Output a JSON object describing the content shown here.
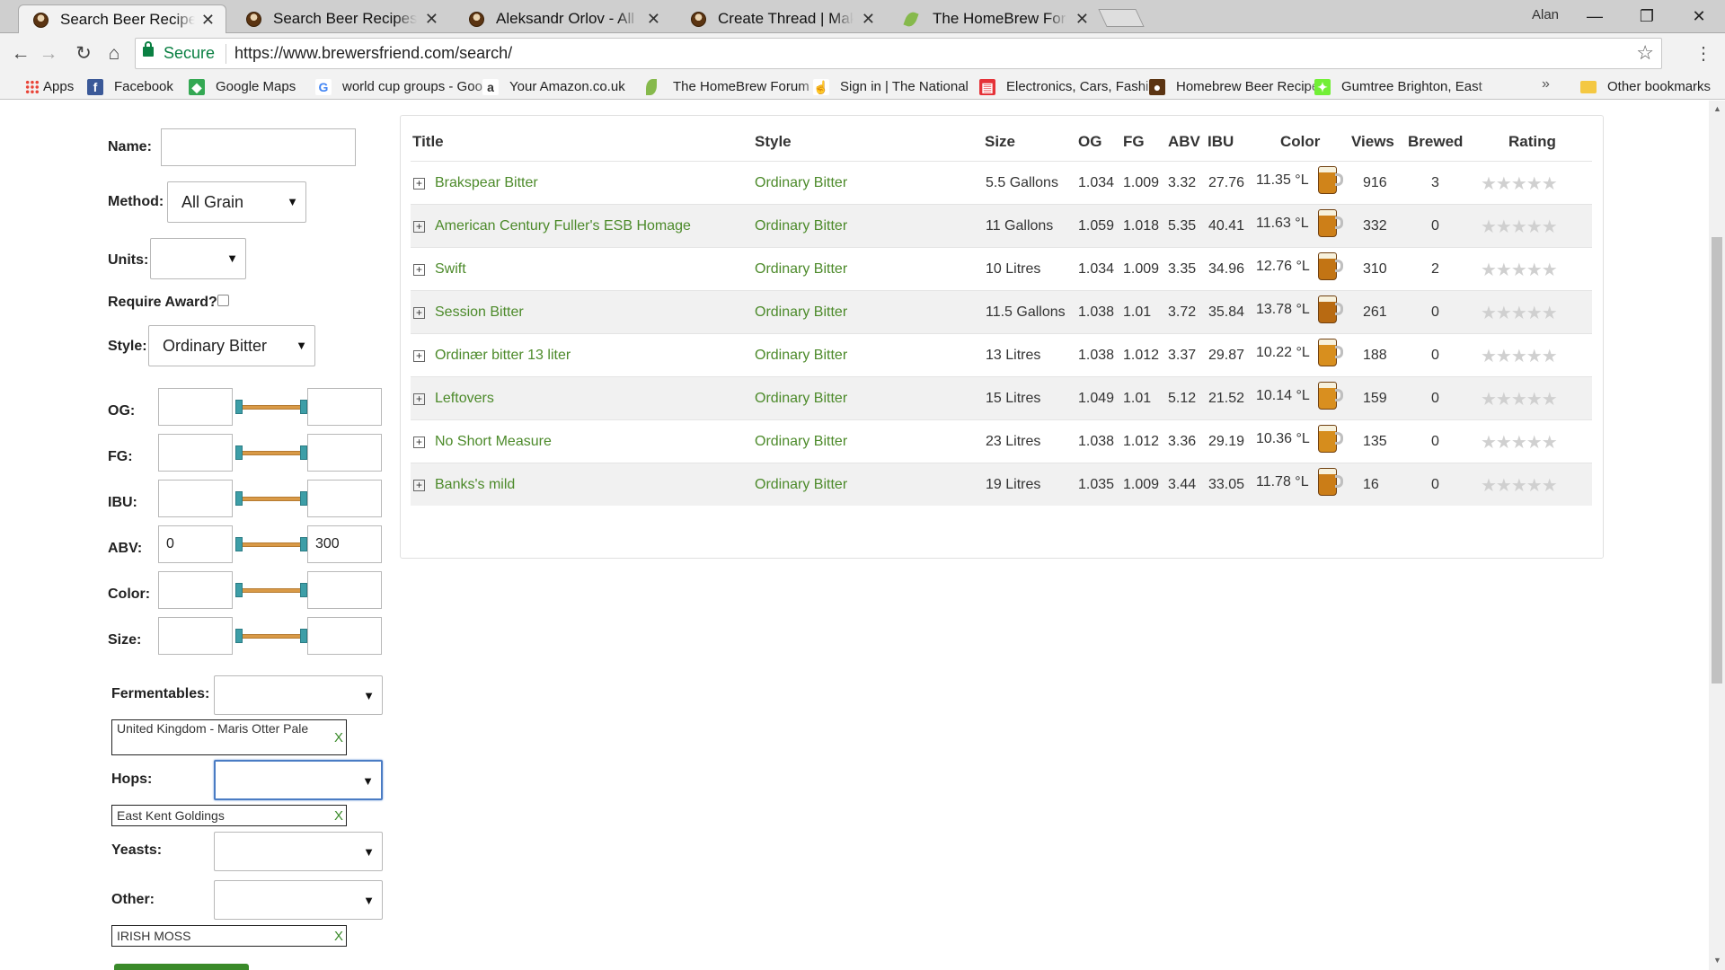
{
  "browser": {
    "tabs": [
      {
        "label": "Search Beer Recipes - Brewer's Friend",
        "active": true
      },
      {
        "label": "Search Beer Recipes - Brewer's Friend",
        "active": false
      },
      {
        "label": "Aleksandr Orlov - All Grain",
        "active": false
      },
      {
        "label": "Create Thread | Make Beer",
        "active": false
      },
      {
        "label": "The HomeBrew Forum",
        "active": false
      }
    ],
    "user": "Alan",
    "secure_label": "Secure",
    "url": "https://www.brewersfriend.com/search/",
    "bookmarks": [
      {
        "label": "Apps",
        "icon": "apps-grid-icon"
      },
      {
        "label": "Facebook",
        "icon": "facebook-icon"
      },
      {
        "label": "Google Maps",
        "icon": "google-maps-icon"
      },
      {
        "label": "world cup groups - Google",
        "icon": "google-icon"
      },
      {
        "label": "Your Amazon.co.uk",
        "icon": "amazon-icon"
      },
      {
        "label": "The HomeBrew Forum",
        "icon": "leaf-icon"
      },
      {
        "label": "Sign in | The National",
        "icon": "national-icon"
      },
      {
        "label": "Electronics, Cars, Fashion",
        "icon": "ebay-icon"
      },
      {
        "label": "Homebrew Beer Recipes",
        "icon": "beer-icon"
      },
      {
        "label": "Gumtree Brighton, East",
        "icon": "gumtree-icon"
      }
    ],
    "other_bookmarks": "Other bookmarks"
  },
  "filters": {
    "name_label": "Name:",
    "name_value": "",
    "method_label": "Method:",
    "method_value": "All Grain",
    "units_label": "Units:",
    "units_value": "",
    "require_award_label": "Require Award?",
    "style_label": "Style:",
    "style_value": "Ordinary Bitter",
    "ranges": [
      {
        "label": "OG:",
        "min": "",
        "max": ""
      },
      {
        "label": "FG:",
        "min": "",
        "max": ""
      },
      {
        "label": "IBU:",
        "min": "",
        "max": ""
      },
      {
        "label": "ABV:",
        "min": "0",
        "max": "300"
      },
      {
        "label": "Color:",
        "min": "",
        "max": ""
      },
      {
        "label": "Size:",
        "min": "",
        "max": ""
      }
    ],
    "fermentables_label": "Fermentables:",
    "fermentables_chip": "United Kingdom - Maris Otter Pale",
    "hops_label": "Hops:",
    "hops_chip": "East Kent Goldings",
    "yeasts_label": "Yeasts:",
    "other_label": "Other:",
    "other_chip": "IRISH MOSS",
    "chip_remove": "X"
  },
  "results": {
    "headers": {
      "title": "Title",
      "style": "Style",
      "size": "Size",
      "og": "OG",
      "fg": "FG",
      "abv": "ABV",
      "ibu": "IBU",
      "color": "Color",
      "views": "Views",
      "brewed": "Brewed",
      "rating": "Rating"
    },
    "rows": [
      {
        "title": "Brakspear Bitter",
        "style": "Ordinary Bitter",
        "size": "5.5 Gallons",
        "og": "1.034",
        "fg": "1.009",
        "abv": "3.32",
        "ibu": "27.76",
        "color": "11.35 °L",
        "beer_color": "#d0841a",
        "views": "916",
        "brewed": "3",
        "rating": 0
      },
      {
        "title": "American Century Fuller's ESB Homage",
        "style": "Ordinary Bitter",
        "size": "11 Gallons",
        "og": "1.059",
        "fg": "1.018",
        "abv": "5.35",
        "ibu": "40.41",
        "color": "11.63 °L",
        "beer_color": "#cd7f18",
        "views": "332",
        "brewed": "0",
        "rating": 0
      },
      {
        "title": "Swift",
        "style": "Ordinary Bitter",
        "size": "10 Litres",
        "og": "1.034",
        "fg": "1.009",
        "abv": "3.35",
        "ibu": "34.96",
        "color": "12.76 °L",
        "beer_color": "#c27414",
        "views": "310",
        "brewed": "2",
        "rating": 0
      },
      {
        "title": "Session Bitter",
        "style": "Ordinary Bitter",
        "size": "11.5 Gallons",
        "og": "1.038",
        "fg": "1.01",
        "abv": "3.72",
        "ibu": "35.84",
        "color": "13.78 °L",
        "beer_color": "#b86a12",
        "views": "261",
        "brewed": "0",
        "rating": 0
      },
      {
        "title": "Ordinær bitter 13 liter",
        "style": "Ordinary Bitter",
        "size": "13 Litres",
        "og": "1.038",
        "fg": "1.012",
        "abv": "3.37",
        "ibu": "29.87",
        "color": "10.22 °L",
        "beer_color": "#d88f1e",
        "views": "188",
        "brewed": "0",
        "rating": 0
      },
      {
        "title": "Leftovers",
        "style": "Ordinary Bitter",
        "size": "15 Litres",
        "og": "1.049",
        "fg": "1.01",
        "abv": "5.12",
        "ibu": "21.52",
        "color": "10.14 °L",
        "beer_color": "#d98f1f",
        "views": "159",
        "brewed": "0",
        "rating": 0
      },
      {
        "title": "No Short Measure",
        "style": "Ordinary Bitter",
        "size": "23 Litres",
        "og": "1.038",
        "fg": "1.012",
        "abv": "3.36",
        "ibu": "29.19",
        "color": "10.36 °L",
        "beer_color": "#d68d1d",
        "views": "135",
        "brewed": "0",
        "rating": 0
      },
      {
        "title": "Banks's mild",
        "style": "Ordinary Bitter",
        "size": "19 Litres",
        "og": "1.035",
        "fg": "1.009",
        "abv": "3.44",
        "ibu": "33.05",
        "color": "11.78 °L",
        "beer_color": "#cb7d17",
        "views": "16",
        "brewed": "0",
        "rating": 0
      }
    ]
  },
  "colors": {
    "link_green": "#4c8a2a",
    "slider_handle": "#3d9ea7",
    "slider_bar": "#d99a47"
  }
}
